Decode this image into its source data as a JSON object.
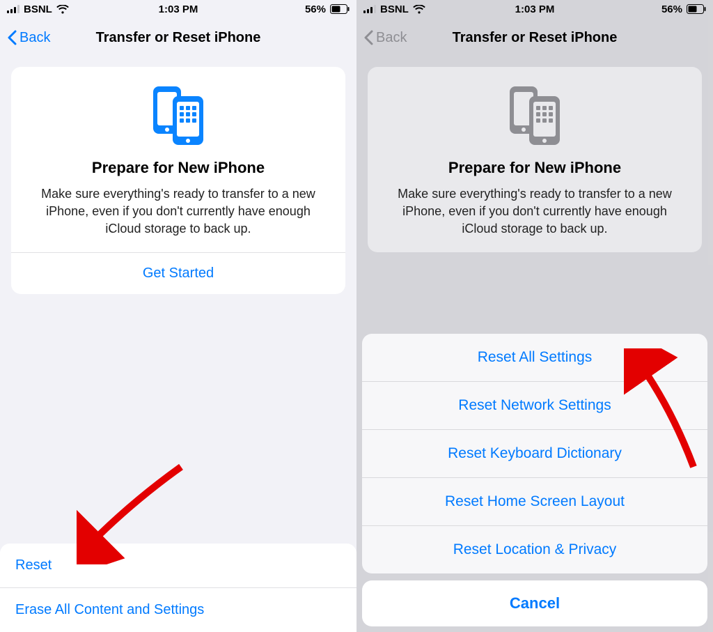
{
  "status": {
    "carrier": "BSNL",
    "time": "1:03 PM",
    "battery_pct": "56%"
  },
  "nav": {
    "back": "Back",
    "title": "Transfer or Reset iPhone"
  },
  "card": {
    "title": "Prepare for New iPhone",
    "body": "Make sure everything's ready to transfer to a new iPhone, even if you don't currently have enough iCloud storage to back up.",
    "cta": "Get Started"
  },
  "bottom": {
    "reset": "Reset",
    "erase": "Erase All Content and Settings"
  },
  "sheet": {
    "options": [
      "Reset All Settings",
      "Reset Network Settings",
      "Reset Keyboard Dictionary",
      "Reset Home Screen Layout",
      "Reset Location & Privacy"
    ],
    "cancel": "Cancel"
  }
}
